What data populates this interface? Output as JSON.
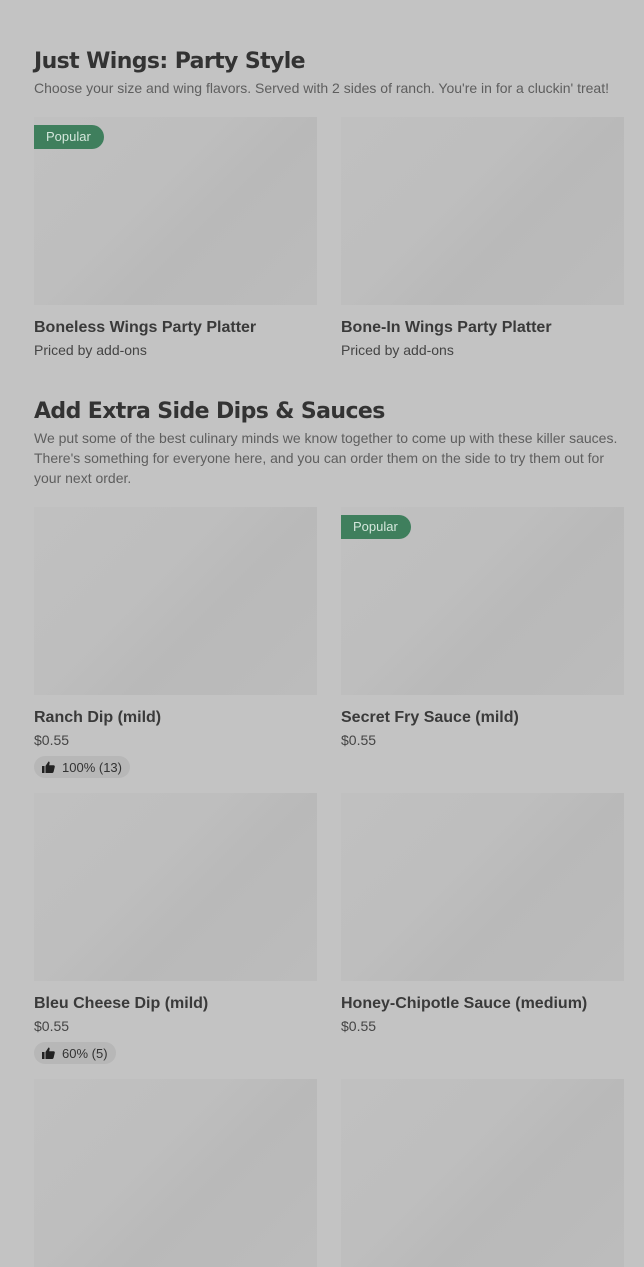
{
  "sections": [
    {
      "title": "Just Wings: Party Style",
      "description": "Choose your size and wing flavors. Served with 2 sides of ranch. You're in for a cluckin' treat!",
      "items": [
        {
          "name": "Boneless Wings Party Platter",
          "price": "Priced by add-ons",
          "badge": "Popular",
          "rating": null
        },
        {
          "name": "Bone-In Wings Party Platter",
          "price": "Priced by add-ons",
          "badge": null,
          "rating": null
        }
      ]
    },
    {
      "title": "Add Extra Side Dips & Sauces",
      "description": "We put some of the best culinary minds we know together to come up with these killer sauces. There's something for everyone here, and you can order them on the side to try them out for your next order.",
      "items": [
        {
          "name": "Ranch Dip (mild)",
          "price": "$0.55",
          "badge": null,
          "rating": "100% (13)"
        },
        {
          "name": "Secret Fry Sauce (mild)",
          "price": "$0.55",
          "badge": "Popular",
          "rating": null
        },
        {
          "name": "Bleu Cheese Dip (mild)",
          "price": "$0.55",
          "badge": null,
          "rating": "60% (5)"
        },
        {
          "name": "Honey-Chipotle Sauce (medium)",
          "price": "$0.55",
          "badge": null,
          "rating": null
        }
      ]
    }
  ],
  "icons": {
    "rating": "thumbs-up-icon"
  },
  "colors": {
    "background": "#c3c3c3",
    "badge": "#3f7f5d"
  }
}
